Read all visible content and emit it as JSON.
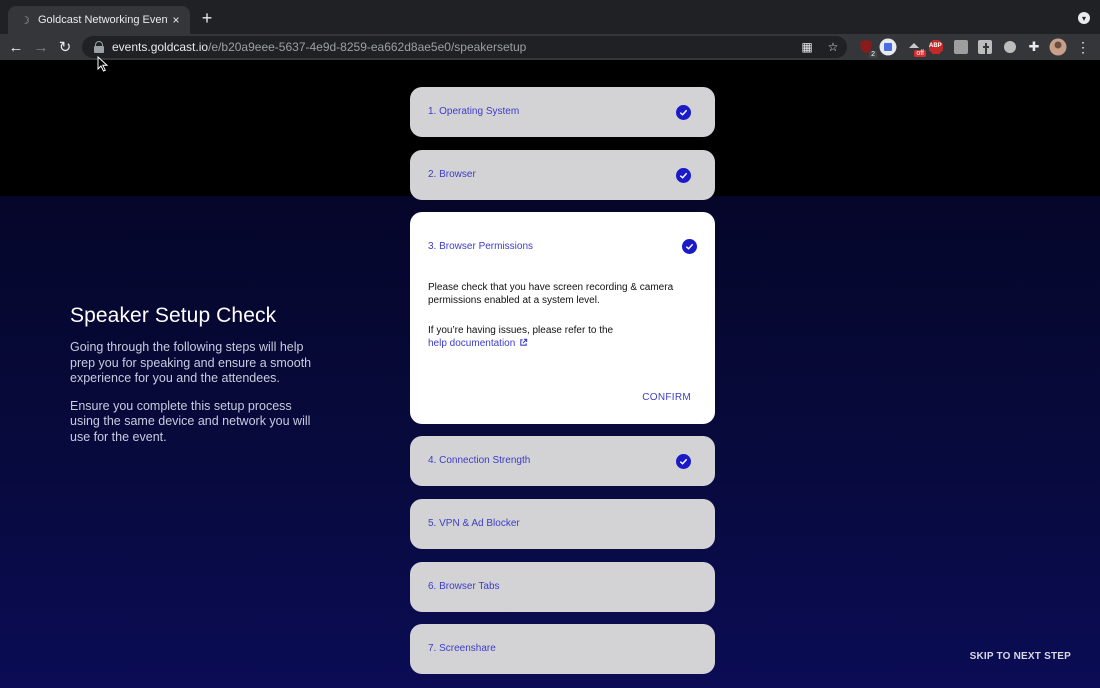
{
  "browser": {
    "tab_title": "Goldcast Networking Event",
    "tab_close": "×",
    "new_tab": "+",
    "url_host": "events.goldcast.io",
    "url_path": "/e/b20a9eee-5637-4e9d-8259-ea662d8ae5e0/speakersetup",
    "back": "←",
    "forward": "→",
    "reload": "↻",
    "extension_badges": [
      "2",
      "off",
      "ABP"
    ]
  },
  "intro": {
    "title": "Speaker Setup Check",
    "paragraph1": "Going through the following steps will help prep you for speaking and ensure a smooth experience for you and the attendees.",
    "paragraph2": "Ensure you complete this setup process using the same device and network you will use for the event."
  },
  "steps": [
    {
      "label": "1. Operating System",
      "completed": true
    },
    {
      "label": "2. Browser",
      "completed": true
    },
    {
      "label": "3. Browser Permissions",
      "completed": true,
      "expanded": true,
      "body": "Please check that you have screen recording & camera permissions enabled at a system level.",
      "help_prefix": "If you’re having issues, please refer to the",
      "help_link": "help documentation",
      "confirm": "CONFIRM"
    },
    {
      "label": "4. Connection Strength",
      "completed": true
    },
    {
      "label": "5. VPN & Ad Blocker",
      "completed": false
    },
    {
      "label": "6. Browser Tabs",
      "completed": false
    },
    {
      "label": "7. Screenshare",
      "completed": false
    }
  ],
  "skip_label": "SKIP TO NEXT STEP",
  "colors": {
    "accent": "#3c3cc9",
    "check": "#1a1ac8",
    "card": "#d3d3d6",
    "card_open": "#ffffff"
  }
}
